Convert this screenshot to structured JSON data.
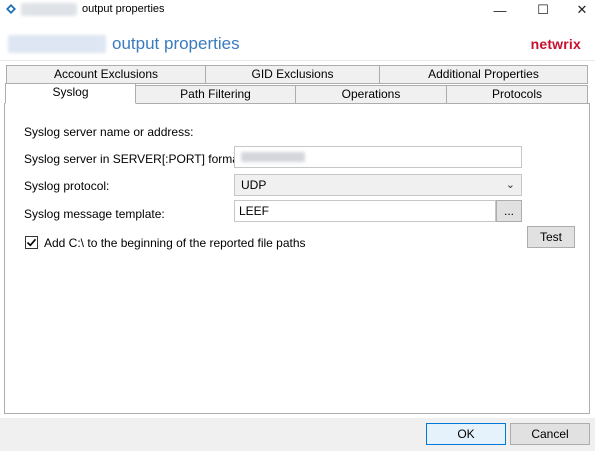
{
  "window": {
    "title": "output properties",
    "controls": {
      "minimize": "—",
      "maximize": "☐",
      "close": "✕"
    }
  },
  "header": {
    "title": "output properties",
    "brand": "netwrix"
  },
  "tabs": {
    "row_top": [
      "Account Exclusions",
      "GID Exclusions",
      "Additional Properties"
    ],
    "row_bottom": [
      "Syslog",
      "Path Filtering",
      "Operations",
      "Protocols"
    ],
    "active": "Syslog"
  },
  "syslog": {
    "section_label": "Syslog server name or address:",
    "server_label": "Syslog server in SERVER[:PORT] format:",
    "server_value": "",
    "protocol_label": "Syslog protocol:",
    "protocol_value": "UDP",
    "template_label": "Syslog message template:",
    "template_value": "LEEF",
    "browse_label": "...",
    "test_label": "Test",
    "checkbox_label": "Add C:\\ to the beginning of the reported file paths",
    "checkbox_checked": true
  },
  "footer": {
    "ok_label": "OK",
    "cancel_label": "Cancel"
  },
  "colors": {
    "accent": "#3b7bbf",
    "brand": "#c8102e",
    "primary_border": "#0078d7"
  },
  "icons": {
    "app": "netwrix-app-icon",
    "chevron": "chevron-down-icon",
    "check": "check-icon"
  }
}
